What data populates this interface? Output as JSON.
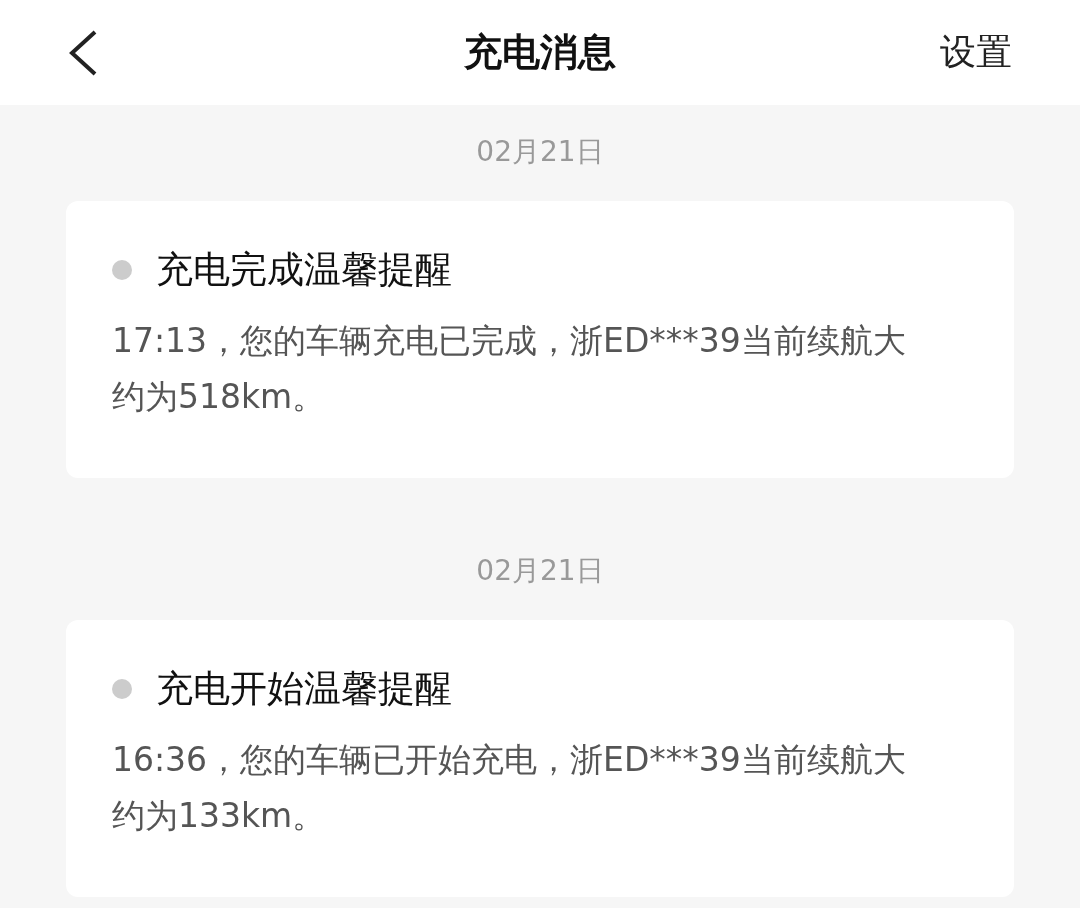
{
  "header": {
    "title": "充电消息",
    "settings": "设置"
  },
  "messages": [
    {
      "date": "02月21日",
      "title": "充电完成温馨提醒",
      "read": true,
      "body": "17:13，您的车辆充电已完成，浙ED***39当前续航大约为518km。"
    },
    {
      "date": "02月21日",
      "title": "充电开始温馨提醒",
      "read": true,
      "body": "16:36，您的车辆已开始充电，浙ED***39当前续航大约为133km。"
    }
  ]
}
